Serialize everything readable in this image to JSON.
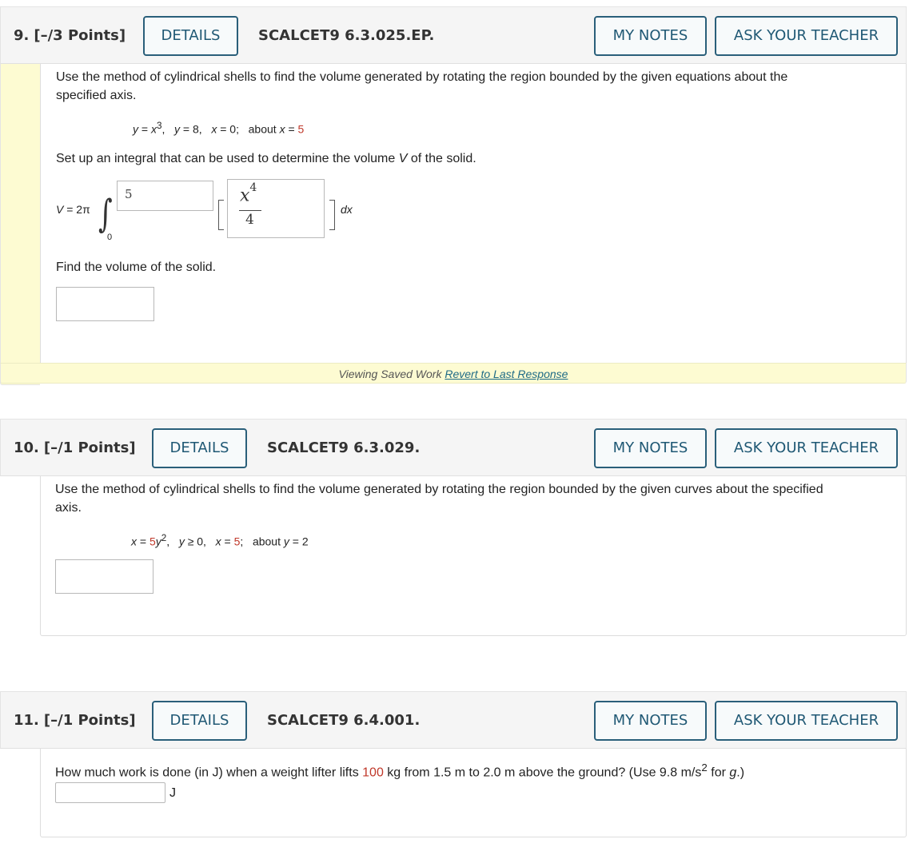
{
  "buttons": {
    "details": "DETAILS",
    "my_notes": "MY NOTES",
    "ask_teacher": "ASK YOUR TEACHER"
  },
  "questions": [
    {
      "number": "9.",
      "points": "[–/3 Points]",
      "code": "SCALCET9 6.3.025.EP.",
      "prompt": "Use the method of cylindrical shells to find the volume generated by rotating the region bounded by the given equations about the",
      "prompt_line2": "specified axis.",
      "equations": {
        "eq1_lhs": "y",
        "eq1_mid": " = ",
        "eq1_var": "x",
        "eq1_exp": "3",
        "eq2": "y",
        "eq2_rest": " = 8,",
        "eq3": "x",
        "eq3_rest": " = 0;",
        "about": "about ",
        "about_var": "x",
        "about_eq": " = ",
        "about_val": "5"
      },
      "setup_text": "Set up an integral that can be used to determine the volume ",
      "setup_var": "V",
      "setup_tail": " of the solid.",
      "integral": {
        "lhs_var": "V",
        "lhs_rest": " = 2π",
        "lower_limit": "0",
        "upper_limit_value": "5",
        "integrand_numerator_var": "x",
        "integrand_numerator_exp": "4",
        "integrand_denominator": "4",
        "differential": "dx"
      },
      "find_text": "Find the volume of the solid.",
      "volume_answer": "",
      "saved_work": {
        "label": "Viewing Saved Work ",
        "link": "Revert to Last Response"
      }
    },
    {
      "number": "10.",
      "points": "[–/1 Points]",
      "code": "SCALCET9 6.3.029.",
      "prompt": "Use the method of cylindrical shells to find the volume generated by rotating the region bounded by the given curves about the specified",
      "prompt_line2": "axis.",
      "equations": {
        "a_var": "x",
        "a_eq": " = ",
        "a_coef": "5",
        "a_var2": "y",
        "a_exp": "2",
        "b_var": "y",
        "b_rest": " ≥ 0,",
        "c_var": "x",
        "c_eq": " = ",
        "c_val": "5",
        "c_semi": ";",
        "about": "about ",
        "about_var": "y",
        "about_rest": " = 2"
      },
      "answer": ""
    },
    {
      "number": "11.",
      "points": "[–/1 Points]",
      "code": "SCALCET9 6.4.001.",
      "prompt_a": "How much work is done (in J) when a weight lifter lifts ",
      "mass": "100",
      "prompt_b": " kg from 1.5 m to 2.0 m above the ground? (Use 9.8 m/s",
      "prompt_exp": "2",
      "prompt_c": " for ",
      "prompt_var": "g",
      "prompt_d": ".)",
      "answer": "",
      "unit": "J"
    }
  ]
}
